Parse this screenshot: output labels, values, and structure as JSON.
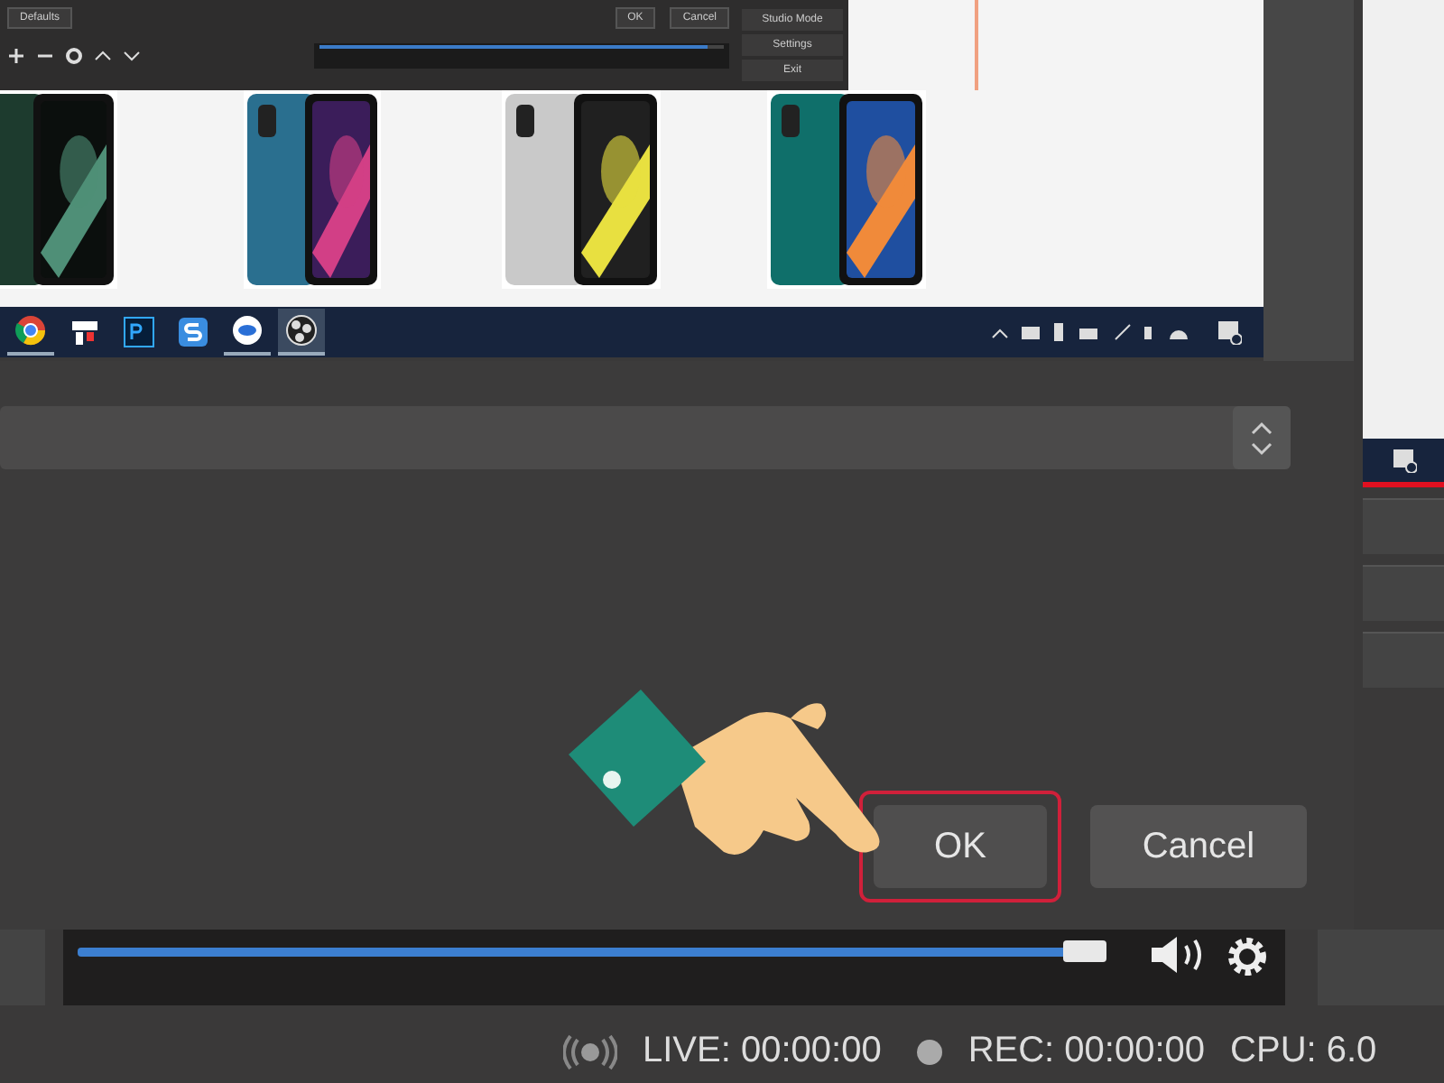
{
  "preview": {
    "mini_window": {
      "left_button": "Defaults",
      "dialog_buttons": [
        "OK",
        "Cancel"
      ],
      "controls": [
        "Studio Mode",
        "Settings",
        "Exit"
      ],
      "volume": {
        "level": 0.96
      }
    },
    "taskbar": {
      "apps": [
        {
          "kind": "browser",
          "selected": true
        },
        {
          "kind": "blocks",
          "selected": false
        },
        {
          "kind": "editor",
          "selected": false
        },
        {
          "kind": "letter",
          "selected": false
        },
        {
          "kind": "chat",
          "selected": true
        },
        {
          "kind": "recorder",
          "selected": true
        }
      ]
    }
  },
  "buttons": [
    {
      "label": "OK",
      "highlighted": true
    },
    {
      "label": "Cancel",
      "highlighted": false
    }
  ],
  "volume": {
    "level": 0.94
  },
  "status_bar": {
    "live": "LIVE: 00:00:00",
    "rec": "REC: 00:00:00",
    "cpu": "CPU: 6.0"
  }
}
